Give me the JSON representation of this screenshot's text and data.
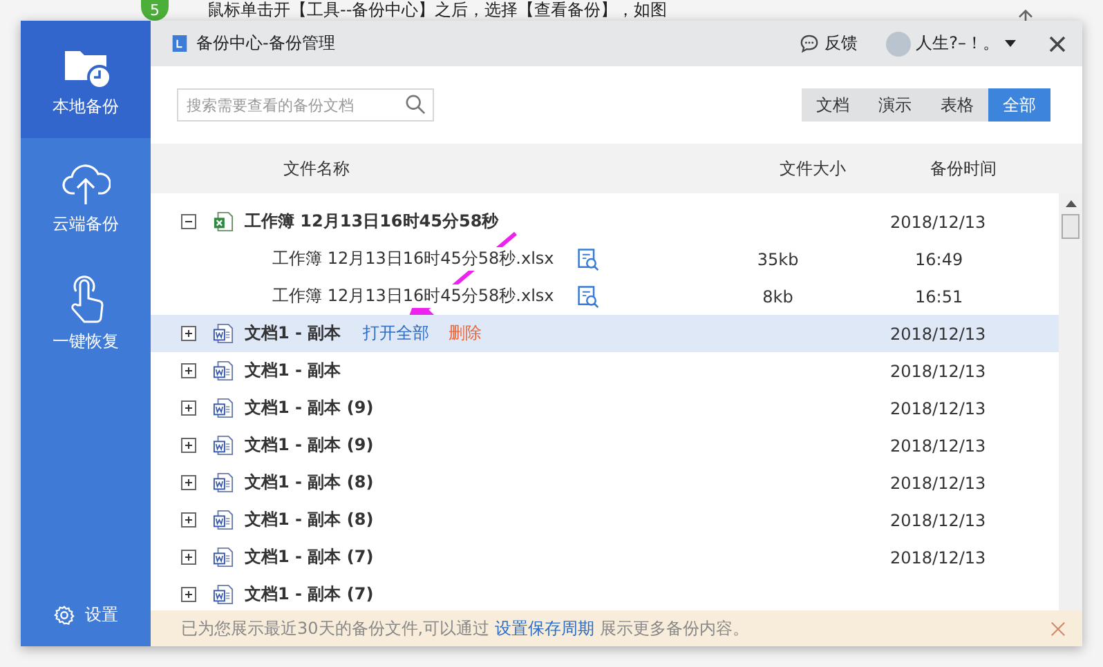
{
  "background_page": {
    "step": "5",
    "text": "鼠标单击开【工具--备份中心】之后，选择【查看备份】，如图"
  },
  "window": {
    "title": "备份中心-备份管理",
    "feedback": "反馈",
    "user": "人生?–！。"
  },
  "sidebar": {
    "items": [
      {
        "label": "本地备份",
        "selected": true
      },
      {
        "label": "云端备份",
        "selected": false
      },
      {
        "label": "一键恢复",
        "selected": false
      }
    ],
    "settings": "设置"
  },
  "search": {
    "placeholder": "搜索需要查看的备份文档"
  },
  "filters": [
    {
      "label": "文档",
      "selected": false
    },
    {
      "label": "演示",
      "selected": false
    },
    {
      "label": "表格",
      "selected": false
    },
    {
      "label": "全部",
      "selected": true
    }
  ],
  "table": {
    "columns": [
      "文件名称",
      "文件大小",
      "备份时间"
    ],
    "rows": [
      {
        "kind": "sheet",
        "name": "工作簿 12月13日16时45分58秒",
        "date": "2018/12/13",
        "expanded": true,
        "selected": false,
        "children": [
          {
            "name": "工作簿 12月13日16时45分58秒.xlsx",
            "size": "35kb",
            "time": "16:49"
          },
          {
            "name": "工作簿 12月13日16时45分58秒.xlsx",
            "size": "8kb",
            "time": "16:51"
          }
        ]
      },
      {
        "kind": "doc",
        "name": "文档1 - 副本",
        "date": "2018/12/13",
        "expanded": false,
        "selected": true,
        "actions": [
          "打开全部",
          "删除"
        ]
      },
      {
        "kind": "doc",
        "name": "文档1 - 副本",
        "date": "2018/12/13",
        "expanded": false,
        "selected": false
      },
      {
        "kind": "doc",
        "name": "文档1 - 副本 (9)",
        "date": "2018/12/13",
        "expanded": false,
        "selected": false
      },
      {
        "kind": "doc",
        "name": "文档1 - 副本 (9)",
        "date": "2018/12/13",
        "expanded": false,
        "selected": false
      },
      {
        "kind": "doc",
        "name": "文档1 - 副本 (8)",
        "date": "2018/12/13",
        "expanded": false,
        "selected": false
      },
      {
        "kind": "doc",
        "name": "文档1 - 副本 (8)",
        "date": "2018/12/13",
        "expanded": false,
        "selected": false
      },
      {
        "kind": "doc",
        "name": "文档1 - 副本 (7)",
        "date": "2018/12/13",
        "expanded": false,
        "selected": false
      },
      {
        "kind": "doc",
        "name": "文档1 - 副本 (7)",
        "expanded": false,
        "selected": false
      }
    ]
  },
  "notice": {
    "text": "已为您展示最近30天的备份文件,可以通过",
    "link": "设置保存周期",
    "text_after": "展示更多备份内容。"
  }
}
